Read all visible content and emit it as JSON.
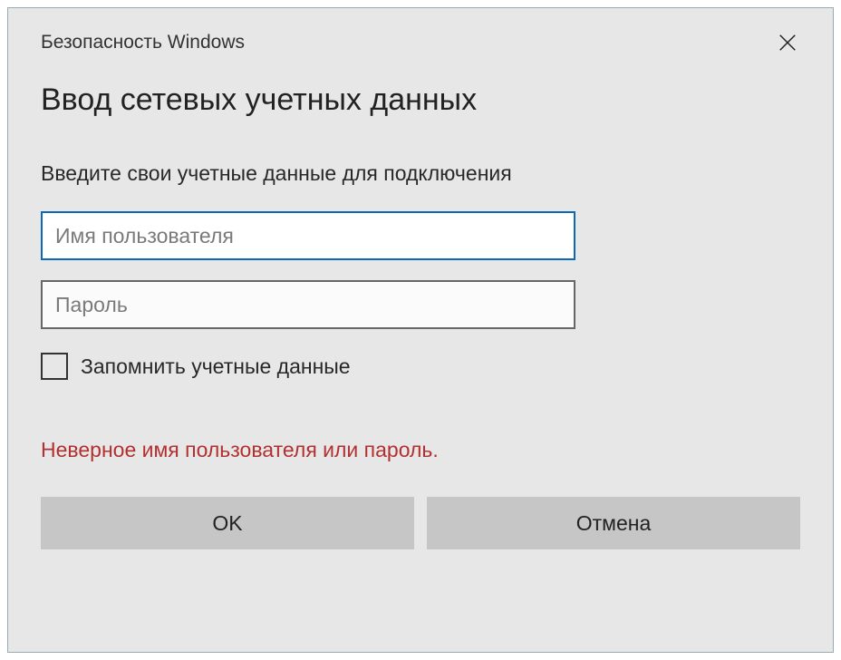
{
  "titlebar": {
    "title": "Безопасность Windows"
  },
  "heading": "Ввод сетевых учетных данных",
  "instruction": "Введите свои учетные данные для подключения",
  "inputs": {
    "username": {
      "placeholder": "Имя пользователя",
      "value": ""
    },
    "password": {
      "placeholder": "Пароль",
      "value": ""
    }
  },
  "checkbox": {
    "label": "Запомнить учетные данные",
    "checked": false
  },
  "error": "Неверное имя пользователя или пароль.",
  "buttons": {
    "ok": "OK",
    "cancel": "Отмена"
  }
}
